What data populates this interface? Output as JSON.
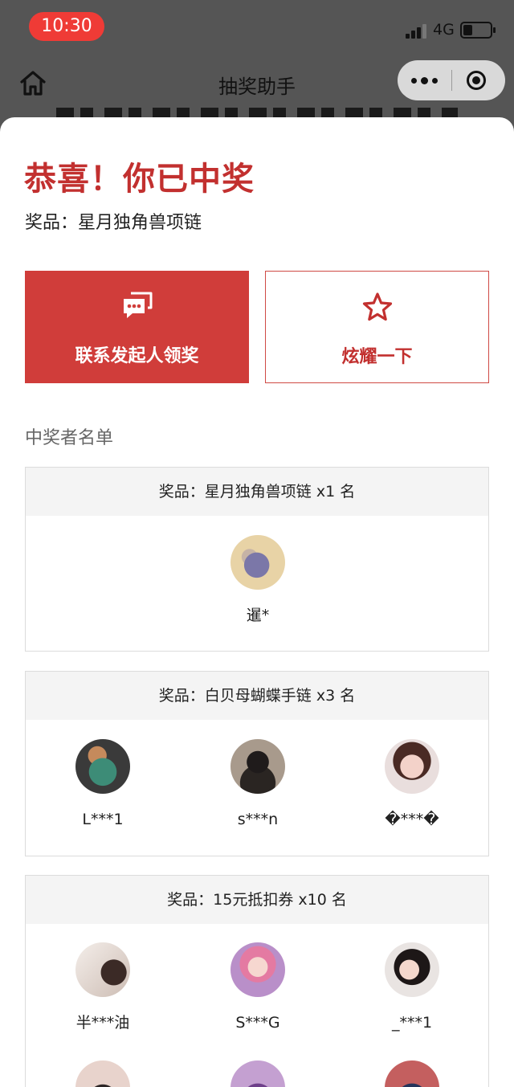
{
  "status_bar": {
    "time": "10:30",
    "network": "4G",
    "battery_level": 0.3
  },
  "nav": {
    "title": "抽奖助手",
    "icons": [
      "home-icon",
      "more-icon",
      "target-icon"
    ]
  },
  "result": {
    "congrats": "恭喜！你已中奖",
    "prize_line": "奖品：星月独角兽项链"
  },
  "actions": {
    "contact_label": "联系发起人领奖",
    "contact_icon": "chat-bubbles-icon",
    "share_label": "炫耀一下",
    "share_icon": "star-icon"
  },
  "winners_heading": "中奖者名单",
  "prize_blocks": [
    {
      "title": "奖品：星月独角兽项链 x1 名",
      "winners": [
        {
          "name": "暹*"
        }
      ]
    },
    {
      "title": "奖品：白贝母蝴蝶手链 x3 名",
      "winners": [
        {
          "name": "L***1"
        },
        {
          "name": "s***n"
        },
        {
          "name": "�***�"
        }
      ]
    },
    {
      "title": "奖品：15元抵扣券 x10 名",
      "winners": [
        {
          "name": "半***油"
        },
        {
          "name": "S***G"
        },
        {
          "name": "_***1"
        }
      ]
    }
  ],
  "colors": {
    "accent": "#d03d3a",
    "accent_text": "#c2302f",
    "time_pill": "#ef3b36"
  }
}
